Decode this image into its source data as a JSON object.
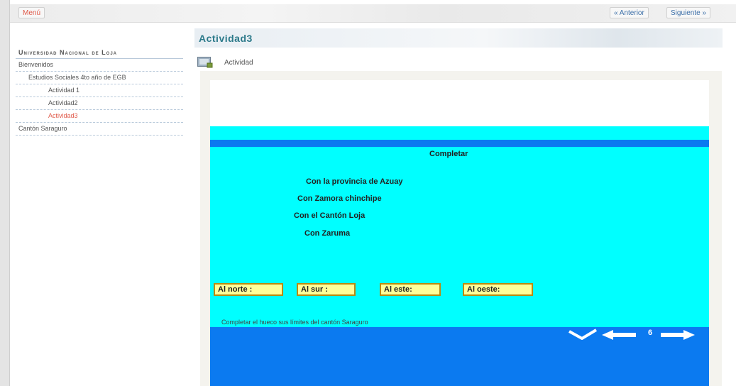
{
  "topbar": {
    "menu_label": "Menú",
    "prev_label": "« Anterior",
    "next_label": "Siguiente »"
  },
  "header": {
    "title": "Actividad3"
  },
  "sidebar": {
    "title": "Universidad Nacional de Loja",
    "items": [
      {
        "label": "Bienvenidos",
        "level": 1,
        "active": false
      },
      {
        "label": "Estudios Sociales 4to año de EGB",
        "level": 2,
        "active": false
      },
      {
        "label": "Actividad 1",
        "level": 3,
        "active": false
      },
      {
        "label": "Actividad2",
        "level": 3,
        "active": false
      },
      {
        "label": "Actividad3",
        "level": 3,
        "active": true
      },
      {
        "label": "Cantón Saraguro",
        "level": 1,
        "active": false
      }
    ]
  },
  "activity": {
    "label": "Actividad",
    "icon": "activity-icon",
    "heading": "Completar",
    "options": [
      "Con la provincia de Azuay",
      "Con Zamora chinchipe",
      "Con el Cantón Loja",
      "Con Zaruma"
    ],
    "targets": [
      "Al norte :",
      "Al sur :",
      "Al este:",
      "Al oeste:"
    ],
    "instruction": "Completar el hueco sus límites del cantón Saraguro",
    "page_number": "6"
  },
  "colors": {
    "accent_red": "#e05a4a",
    "title_teal": "#2c7a8a",
    "cyan": "#00ffff",
    "blue": "#0b7af0",
    "target_fill": "#ffff99"
  }
}
